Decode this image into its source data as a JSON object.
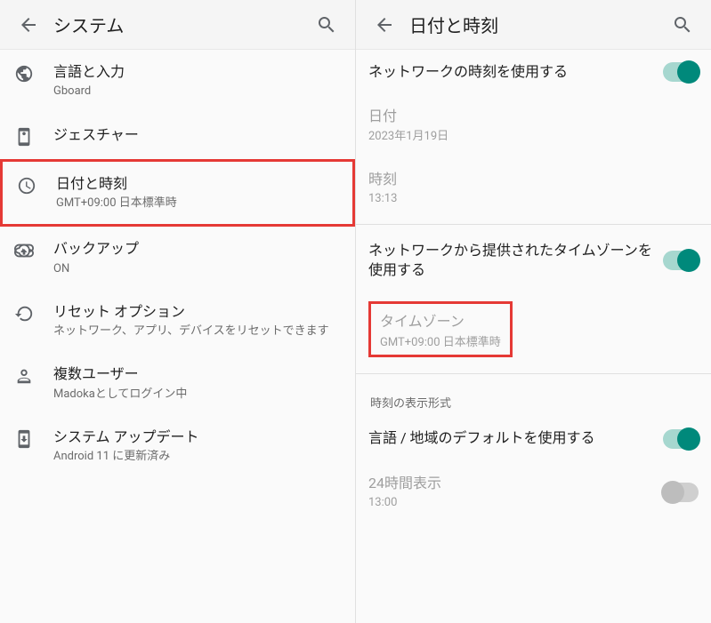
{
  "left": {
    "title": "システム",
    "items": [
      {
        "label": "言語と入力",
        "sub": "Gboard",
        "icon": "globe"
      },
      {
        "label": "ジェスチャー",
        "sub": "",
        "icon": "gesture"
      },
      {
        "label": "日付と時刻",
        "sub": "GMT+09:00 日本標準時",
        "icon": "clock",
        "highlight": true
      },
      {
        "label": "バックアップ",
        "sub": "ON",
        "icon": "cloud"
      },
      {
        "label": "リセット オプション",
        "sub": "ネットワーク、アプリ、デバイスをリセットできます",
        "icon": "restore"
      },
      {
        "label": "複数ユーザー",
        "sub": "Madokaとしてログイン中",
        "icon": "user"
      },
      {
        "label": "システム アップデート",
        "sub": "Android 11 に更新済み",
        "icon": "update"
      }
    ]
  },
  "right": {
    "title": "日付と時刻",
    "netTime": {
      "label": "ネットワークの時刻を使用する",
      "on": true
    },
    "date": {
      "label": "日付",
      "value": "2023年1月19日"
    },
    "time": {
      "label": "時刻",
      "value": "13:13"
    },
    "netZone": {
      "label": "ネットワークから提供されたタイムゾーンを使用する",
      "on": true
    },
    "timezone": {
      "label": "タイムゾーン",
      "value": "GMT+09:00 日本標準時",
      "highlight": true
    },
    "formatHeader": "時刻の表示形式",
    "useLocale": {
      "label": "言語 / 地域のデフォルトを使用する",
      "on": true
    },
    "use24": {
      "label": "24時間表示",
      "value": "13:00",
      "on": false
    }
  }
}
